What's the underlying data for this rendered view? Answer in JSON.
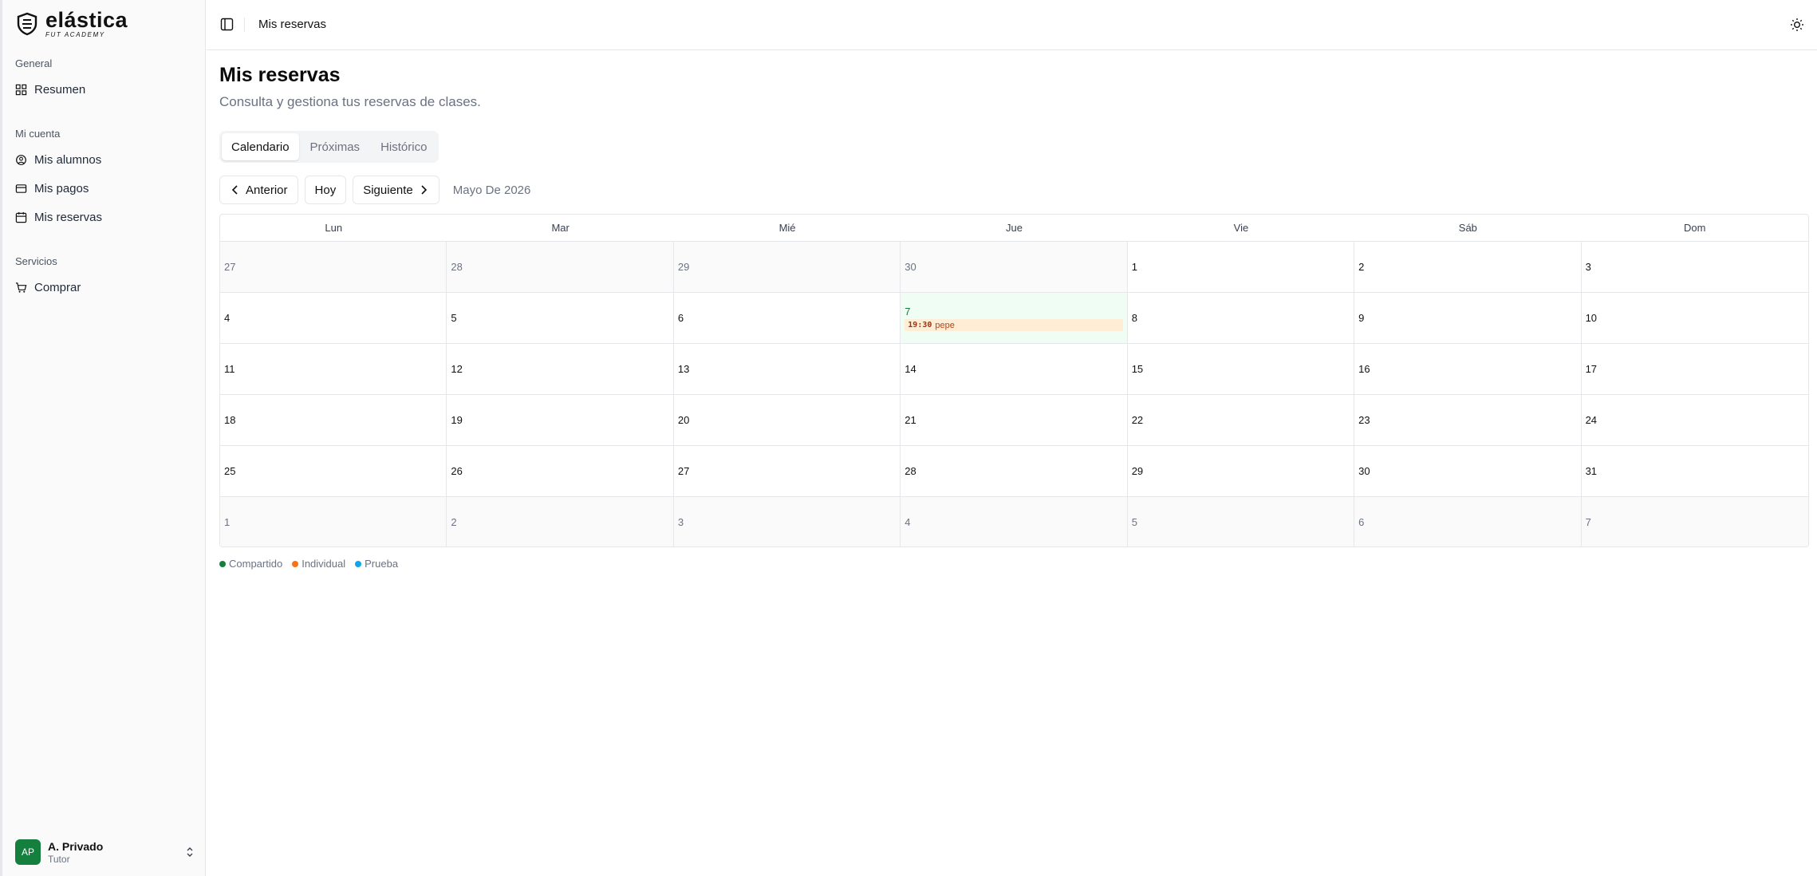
{
  "brand": {
    "name": "elástica",
    "tagline": "FUT ACADEMY"
  },
  "sidebar": {
    "sections": [
      {
        "title": "General",
        "items": [
          {
            "label": "Resumen",
            "icon": "grid-icon"
          }
        ]
      },
      {
        "title": "Mi cuenta",
        "items": [
          {
            "label": "Mis alumnos",
            "icon": "users-icon"
          },
          {
            "label": "Mis pagos",
            "icon": "credit-card-icon"
          },
          {
            "label": "Mis reservas",
            "icon": "calendar-icon"
          }
        ]
      },
      {
        "title": "Servicios",
        "items": [
          {
            "label": "Comprar",
            "icon": "cart-icon"
          }
        ]
      }
    ],
    "user": {
      "initials": "AP",
      "name": "A. Privado",
      "role": "Tutor"
    }
  },
  "header": {
    "title": "Mis reservas"
  },
  "main": {
    "title": "Mis reservas",
    "subtitle": "Consulta y gestiona tus reservas de clases.",
    "tabs": [
      {
        "label": "Calendario",
        "active": true
      },
      {
        "label": "Próximas",
        "active": false
      },
      {
        "label": "Histórico",
        "active": false
      }
    ],
    "nav": {
      "prev": "Anterior",
      "today": "Hoy",
      "next": "Siguiente",
      "month": "Mayo De 2026"
    },
    "weekdays": [
      "Lun",
      "Mar",
      "Mié",
      "Jue",
      "Vie",
      "Sáb",
      "Dom"
    ],
    "days": [
      [
        "27",
        "28",
        "29",
        "30",
        "1",
        "2",
        "3"
      ],
      [
        "4",
        "5",
        "6",
        "7",
        "8",
        "9",
        "10"
      ],
      [
        "11",
        "12",
        "13",
        "14",
        "15",
        "16",
        "17"
      ],
      [
        "18",
        "19",
        "20",
        "21",
        "22",
        "23",
        "24"
      ],
      [
        "25",
        "26",
        "27",
        "28",
        "29",
        "30",
        "31"
      ],
      [
        "1",
        "2",
        "3",
        "4",
        "5",
        "6",
        "7"
      ]
    ],
    "event": {
      "time": "19:30",
      "name": "pepe"
    },
    "legend": [
      {
        "label": "Compartido",
        "color": "#15803d"
      },
      {
        "label": "Individual",
        "color": "#f97316"
      },
      {
        "label": "Prueba",
        "color": "#0ea5e9"
      }
    ]
  }
}
